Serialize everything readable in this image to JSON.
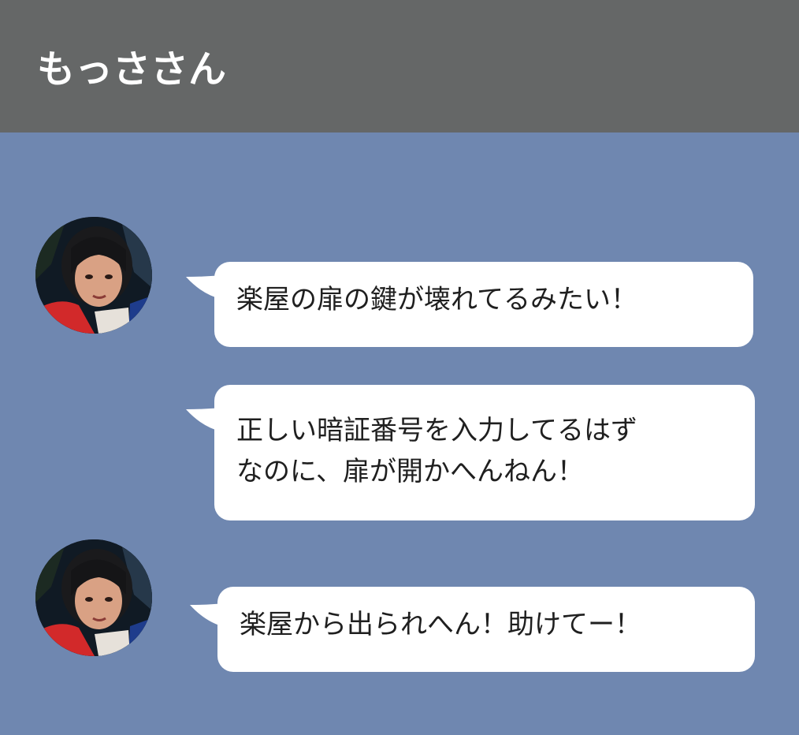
{
  "header": {
    "title": "もっささん"
  },
  "colors": {
    "header_bg": "#656767",
    "chat_bg": "#6f87b0",
    "bubble_bg": "#ffffff",
    "text": "#1f1f1f"
  },
  "messages": [
    {
      "sender_avatar": "avatar-photo",
      "lines": [
        "楽屋の扉の鍵が壊れてるみたい！"
      ]
    },
    {
      "sender_avatar": "",
      "lines": [
        "正しい暗証番号を入力してるはず",
        "なのに、扉が開かへんねん！"
      ]
    },
    {
      "sender_avatar": "avatar-photo",
      "lines": [
        "楽屋から出られへん！助けてー！"
      ]
    }
  ]
}
